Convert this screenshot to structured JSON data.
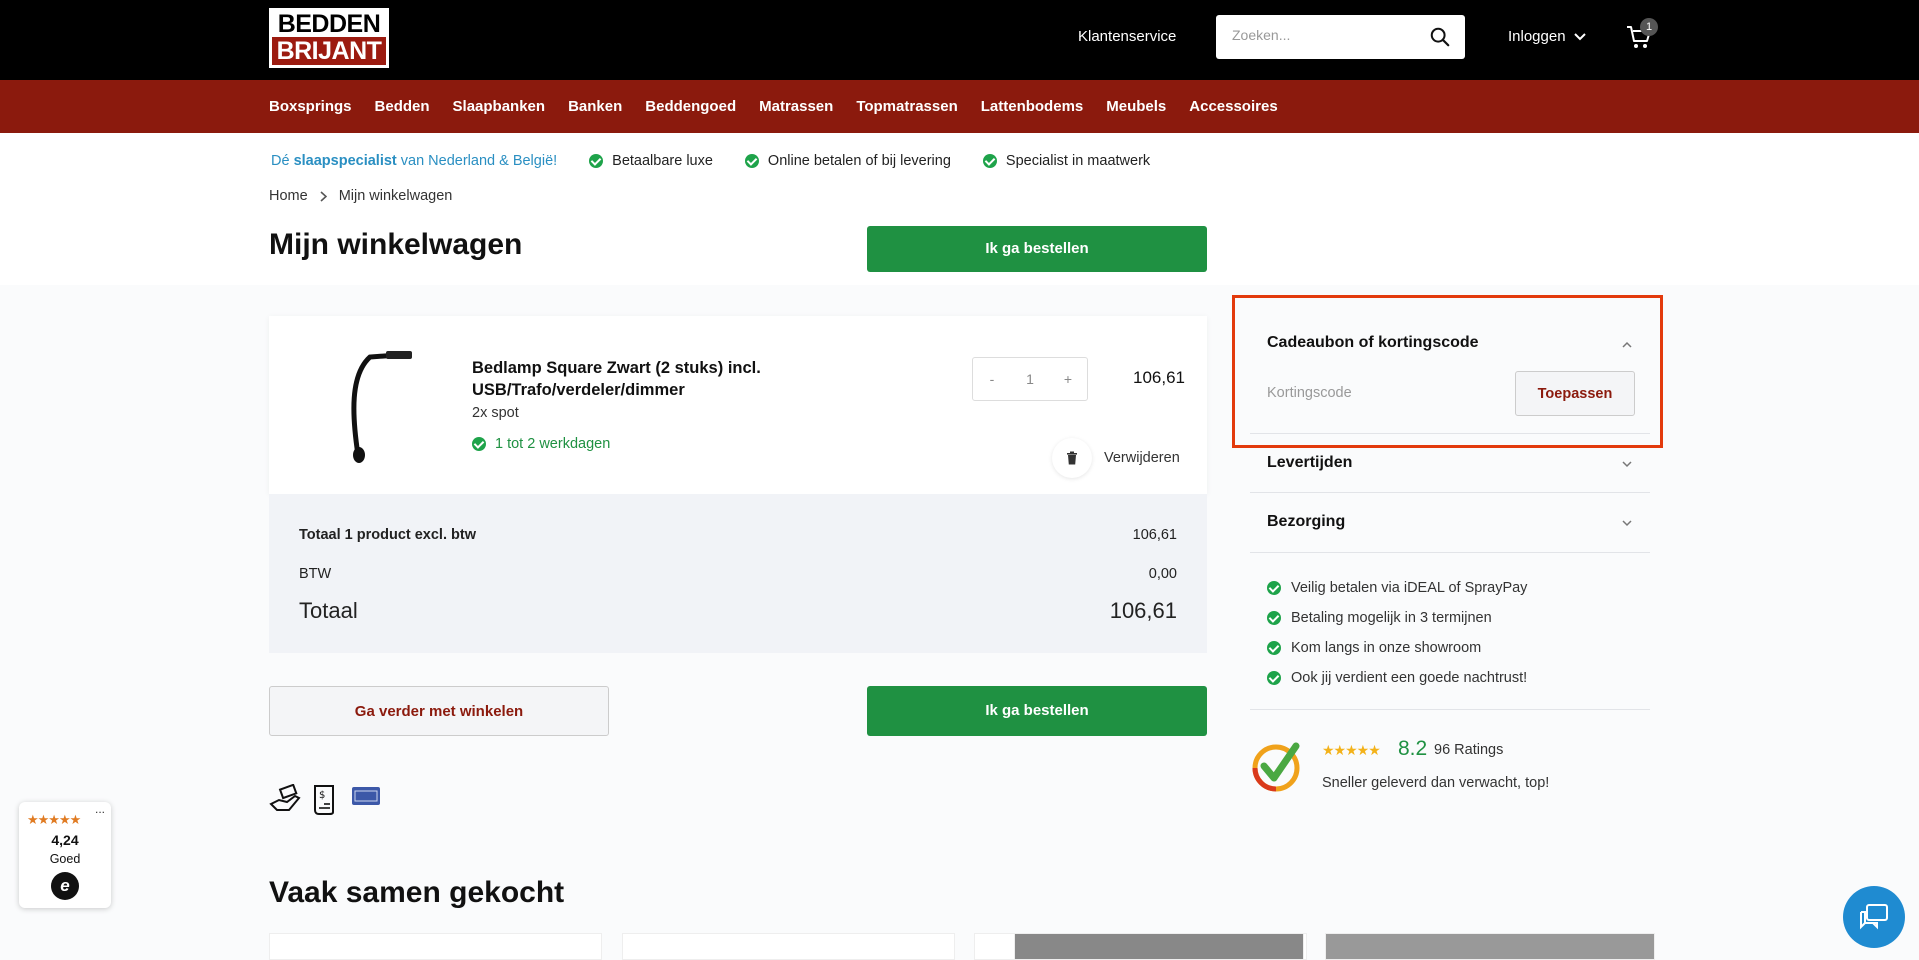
{
  "header": {
    "logo_line1": "BEDDEN",
    "logo_line2": "BRIJANT",
    "customer_service": "Klantenservice",
    "search_placeholder": "Zoeken...",
    "login": "Inloggen",
    "cart_count": "1"
  },
  "nav": [
    "Boxsprings",
    "Bedden",
    "Slaapbanken",
    "Banken",
    "Beddengoed",
    "Matrassen",
    "Topmatrassen",
    "Lattenbodems",
    "Meubels",
    "Accessoires"
  ],
  "usp": {
    "tag_prefix": "Dé ",
    "tag_bold": "slaapspecialist",
    "tag_suffix": " van Nederland & België!",
    "items": [
      "Betaalbare luxe",
      "Online betalen of bij levering",
      "Specialist in maatwerk"
    ]
  },
  "breadcrumb": {
    "home": "Home",
    "current": "Mijn winkelwagen"
  },
  "page_title": "Mijn winkelwagen",
  "order_button": "Ik ga bestellen",
  "product": {
    "name": "Bedlamp Square Zwart (2 stuks) incl. USB/Trafo/verdeler/dimmer",
    "variant": "2x spot",
    "delivery": "1 tot 2 werkdagen",
    "qty_minus": "-",
    "qty": "1",
    "qty_plus": "+",
    "price": "106,61",
    "remove": "Verwijderen"
  },
  "totals": {
    "subtotal_label": "Totaal 1 product excl. btw",
    "subtotal_value": "106,61",
    "vat_label": "BTW",
    "vat_value": "0,00",
    "total_label": "Totaal",
    "total_value": "106,61"
  },
  "continue_button": "Ga verder met winkelen",
  "frequently_bought": "Vaak samen gekocht",
  "sidebar": {
    "coupon_title": "Cadeaubon of kortingscode",
    "coupon_placeholder": "Kortingscode",
    "apply_button": "Toepassen",
    "delivery_times": "Levertijden",
    "shipping": "Bezorging",
    "benefits": [
      "Veilig betalen via iDEAL of SprayPay",
      "Betaling mogelijk in 3 termijnen",
      "Kom langs in onze showroom",
      "Ook jij verdient een goede nachtrust!"
    ],
    "rating_stars": "★★★★★",
    "rating_score": "8.2",
    "rating_count": "96 Ratings",
    "rating_quote": "Sneller geleverd dan verwacht, top!"
  },
  "trusted": {
    "stars": "★★★★★",
    "menu": "...",
    "score": "4,24",
    "label": "Goed",
    "logo_letter": "e"
  },
  "colors": {
    "header_bg": "#000000",
    "nav_bg": "#8b1a0d",
    "primary_green": "#1f9142",
    "highlight_border": "#e33a0c",
    "chat_blue": "#1f8bd1"
  }
}
